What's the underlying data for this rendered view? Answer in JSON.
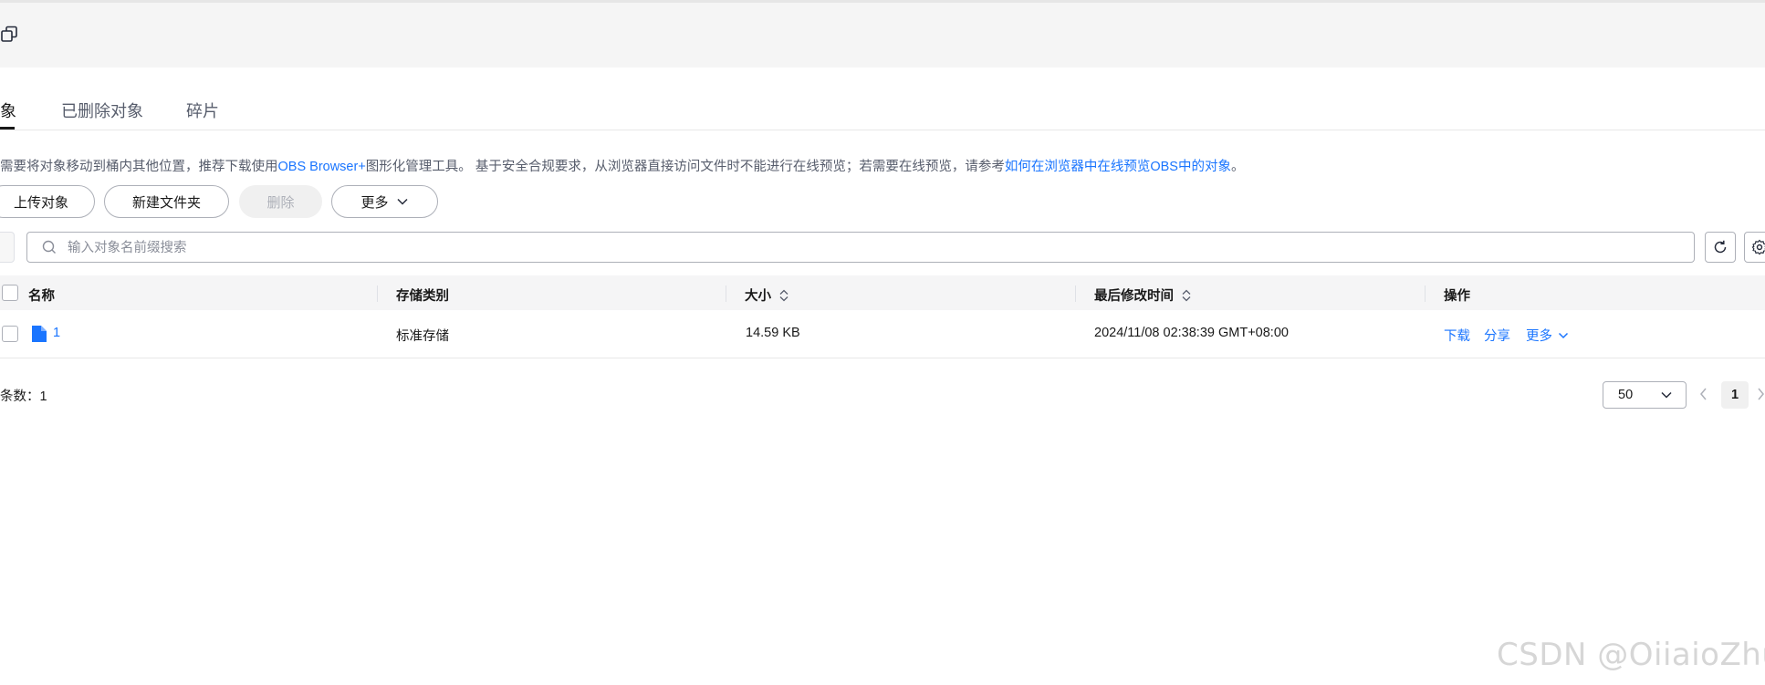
{
  "tabs": [
    {
      "label": "象",
      "active": true
    },
    {
      "label": "已删除对象",
      "active": false
    },
    {
      "label": "碎片",
      "active": false
    }
  ],
  "notice": {
    "text_before": "需要将对象移动到桶内其他位置，推荐下载使用",
    "link1": "OBS Browser+",
    "text_middle": "图形化管理工具。 基于安全合规要求，从浏览器直接访问文件时不能进行在线预览；若需要在线预览，请参考",
    "link2": "如何在浏览器中在线预览OBS中的对象",
    "text_end": "。"
  },
  "toolbar": {
    "upload": "上传对象",
    "new_folder": "新建文件夹",
    "delete": "删除",
    "more": "更多"
  },
  "search": {
    "placeholder": "输入对象名前缀搜索",
    "value": ""
  },
  "table": {
    "columns": [
      "名称",
      "存储类别",
      "大小",
      "最后修改时间",
      "操作"
    ],
    "rows": [
      {
        "name": "1",
        "storage_class": "标准存储",
        "size": "14.59 KB",
        "modified": "2024/11/08 02:38:39 GMT+08:00",
        "actions": [
          "下载",
          "分享",
          "更多"
        ]
      }
    ]
  },
  "pagination": {
    "total": "条数：1",
    "page_size": "50",
    "current_page": "1"
  },
  "watermark": "CSDN @OiiaioZhu",
  "colors": {
    "link": "#1a75ff",
    "file_icon": "#1a75ff",
    "header_bg": "#f5f5f6",
    "top_bar_bg": "#f5f5f5"
  }
}
